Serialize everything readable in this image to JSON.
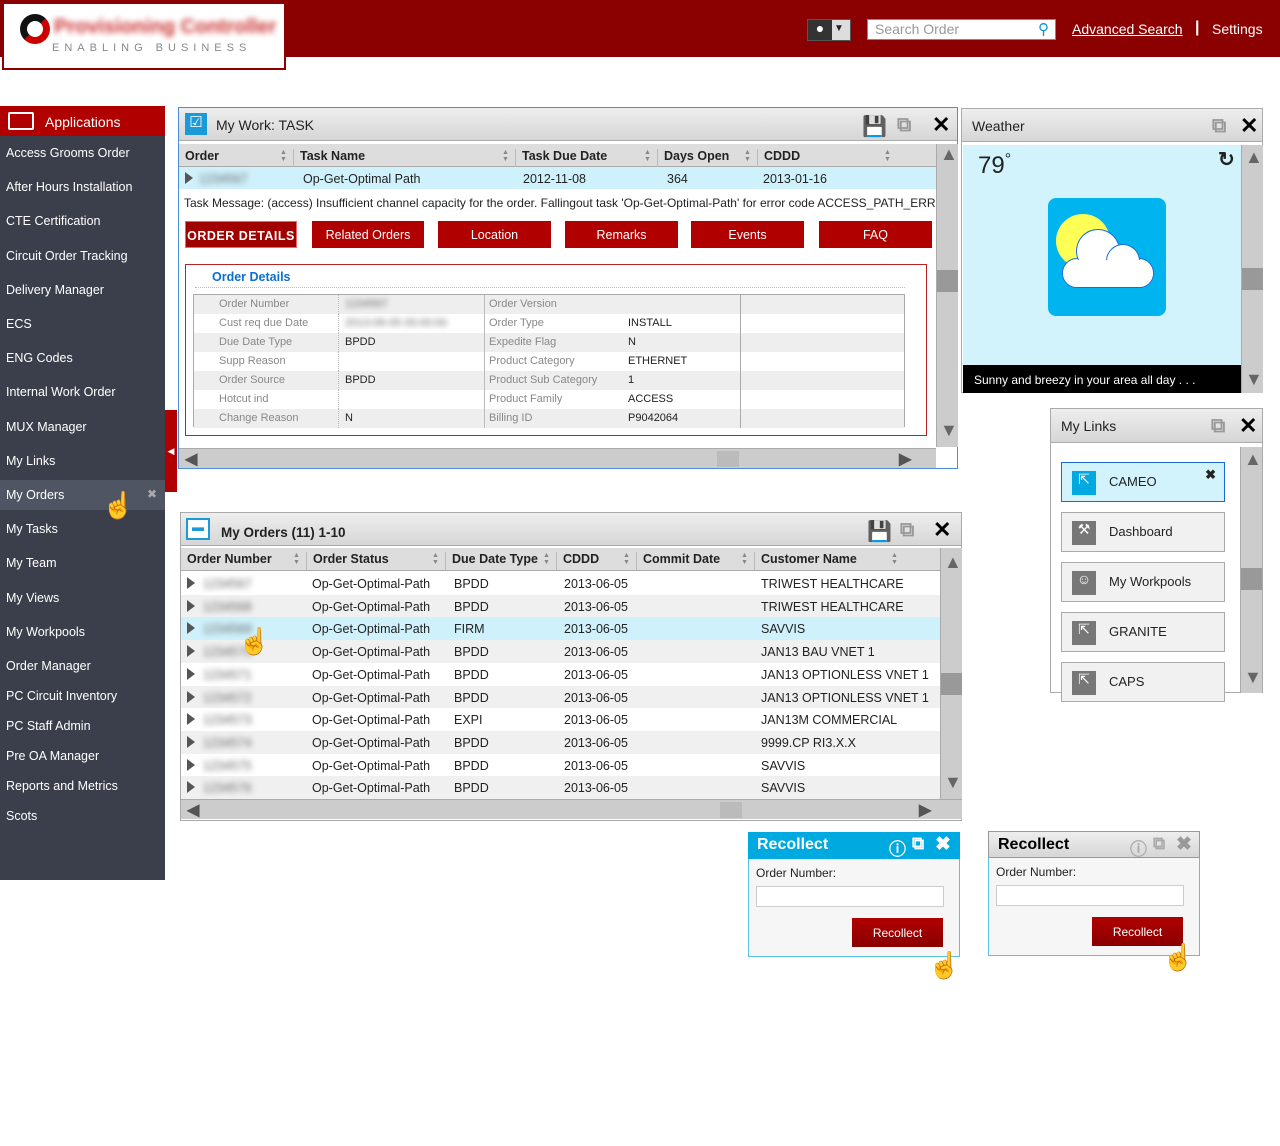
{
  "header": {
    "logo_name": "Provisioning Controller",
    "logo_tagline": "ENABLING BUSINESS",
    "search_placeholder": "Search Order",
    "advanced_search": "Advanced Search",
    "separator": "|",
    "settings": "Settings",
    "brand_color": "#8b0000"
  },
  "sidebar": {
    "title": "Applications",
    "items": [
      "Access Grooms Order",
      "After Hours Installation",
      "CTE Certification",
      "Circuit Order Tracking",
      "Delivery Manager",
      "ECS",
      "ENG Codes",
      "Internal Work Order",
      "MUX Manager",
      "My Links",
      "My Orders",
      "My Tasks",
      "My Team",
      "My Views",
      "My Workpools",
      "Order Manager",
      "PC Circuit Inventory",
      "PC Staff Admin",
      "Pre OA Manager",
      "Reports and Metrics",
      "Scots"
    ],
    "active": "My Orders"
  },
  "task": {
    "title": "My Work: TASK",
    "columns": [
      "Order",
      "Task Name",
      "Task Due Date",
      "Days Open",
      "CDDD"
    ],
    "row": {
      "order": "1234567",
      "task_name": "Op-Get-Optimal Path",
      "due": "2012-11-08",
      "days_open": "364",
      "cddd": "2013-01-16"
    },
    "message": "Task Message: (access) Insufficient channel capacity for the order. Fallingout task 'Op-Get-Optimal-Path' for error code ACCESS_PATH_ERR",
    "buttons": [
      "ORDER DETAILS",
      "Related Orders",
      "Location",
      "Remarks",
      "Events",
      "FAQ"
    ],
    "details_title": "Order Details",
    "details": [
      [
        "Order Number",
        "1234567",
        "Order Version",
        ""
      ],
      [
        "Cust req due Date",
        "2013-06-05 00:00:00",
        "Order Type",
        "INSTALL"
      ],
      [
        "Due Date Type",
        "BPDD",
        "Expedite Flag",
        "N"
      ],
      [
        "Supp Reason",
        "",
        "Product Category",
        "ETHERNET"
      ],
      [
        "Order Source",
        "BPDD",
        "Product Sub Category",
        "1"
      ],
      [
        "Hotcut ind",
        "",
        "Product Family",
        "ACCESS"
      ],
      [
        "Change Reason",
        "N",
        "Billing ID",
        "P9042064"
      ]
    ]
  },
  "orders": {
    "title": "My Orders (11) 1-10",
    "columns": [
      "Order Number",
      "Order Status",
      "Due Date Type",
      "CDDD",
      "Commit Date",
      "Customer Name"
    ],
    "rows": [
      [
        "1234567",
        "Op-Get-Optimal-Path",
        "BPDD",
        "2013-06-05",
        "",
        "TRIWEST HEALTHCARE"
      ],
      [
        "1234568",
        "Op-Get-Optimal-Path",
        "BPDD",
        "2013-06-05",
        "",
        "TRIWEST HEALTHCARE"
      ],
      [
        "1234569",
        "Op-Get-Optimal-Path",
        "FIRM",
        "2013-06-05",
        "",
        "SAVVIS"
      ],
      [
        "1234570",
        "Op-Get-Optimal-Path",
        "BPDD",
        "2013-06-05",
        "",
        "JAN13 BAU VNET 1"
      ],
      [
        "1234571",
        "Op-Get-Optimal-Path",
        "BPDD",
        "2013-06-05",
        "",
        "JAN13 OPTIONLESS VNET 1"
      ],
      [
        "1234572",
        "Op-Get-Optimal-Path",
        "BPDD",
        "2013-06-05",
        "",
        "JAN13 OPTIONLESS VNET 1"
      ],
      [
        "1234573",
        "Op-Get-Optimal-Path",
        "EXPI",
        "2013-06-05",
        "",
        "JAN13M COMMERCIAL"
      ],
      [
        "1234574",
        "Op-Get-Optimal-Path",
        "BPDD",
        "2013-06-05",
        "",
        "9999.CP RI3.X.X"
      ],
      [
        "1234575",
        "Op-Get-Optimal-Path",
        "BPDD",
        "2013-06-05",
        "",
        "SAVVIS"
      ],
      [
        "1234576",
        "Op-Get-Optimal-Path",
        "BPDD",
        "2013-06-05",
        "",
        "SAVVIS"
      ]
    ],
    "selected_row": 2
  },
  "weather": {
    "title": "Weather",
    "temperature": "79",
    "degree": "°",
    "caption": "Sunny and breezy in your area all day . . .",
    "icon": "partly-cloudy-icon"
  },
  "links": {
    "title": "My Links",
    "items": [
      {
        "label": "CAMEO",
        "icon": "external-link-icon"
      },
      {
        "label": "Dashboard",
        "icon": "tools-icon"
      },
      {
        "label": "My Workpools",
        "icon": "group-icon"
      },
      {
        "label": "GRANITE",
        "icon": "external-link-icon"
      },
      {
        "label": "CAPS",
        "icon": "external-link-icon"
      }
    ]
  },
  "recollect_active": {
    "title": "Recollect",
    "label": "Order Number:",
    "value": "",
    "button": "Recollect"
  },
  "recollect_inactive": {
    "title": "Recollect",
    "label": "Order Number:",
    "value": "",
    "button": "Recollect"
  }
}
